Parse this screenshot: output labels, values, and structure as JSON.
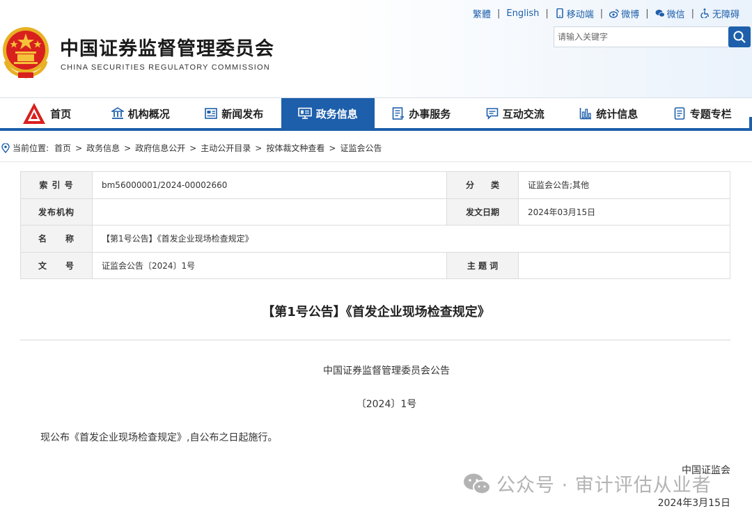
{
  "header": {
    "title": "中国证券监督管理委员会",
    "subtitle": "CHINA SECURITIES REGULATORY COMMISSION",
    "toplinks": {
      "traditional": "繁體",
      "english": "English",
      "mobile": "移动端",
      "weibo": "微博",
      "wechat": "微信",
      "accessibility": "无障碍"
    },
    "search": {
      "placeholder": "请输入关键字"
    }
  },
  "nav": {
    "items": [
      {
        "label": "首页",
        "icon": "emblem-icon"
      },
      {
        "label": "机构概况",
        "icon": "building-icon"
      },
      {
        "label": "新闻发布",
        "icon": "news-icon"
      },
      {
        "label": "政务信息",
        "icon": "monitor-icon",
        "active": true
      },
      {
        "label": "办事服务",
        "icon": "list-icon"
      },
      {
        "label": "互动交流",
        "icon": "chat-icon"
      },
      {
        "label": "统计信息",
        "icon": "bar-chart-icon"
      },
      {
        "label": "专题专栏",
        "icon": "document-icon"
      }
    ],
    "accent_color": "#1d5fab"
  },
  "breadcrumb": {
    "prefix": "当前位置:",
    "items": [
      "首页",
      "政务信息",
      "政府信息公开",
      "主动公开目录",
      "按体裁文种查看",
      "证监会公告"
    ],
    "separator": ">"
  },
  "meta": {
    "index_label": "索 引 号",
    "index_value": "bm56000001/2024-00002660",
    "category_label": "分　　类",
    "category_value": "证监会公告;其他",
    "issuer_label": "发布机构",
    "issuer_value": "",
    "date_label": "发文日期",
    "date_value": "2024年03月15日",
    "name_label": "名　　称",
    "name_value": "【第1号公告】《首发企业现场检查规定》",
    "docno_label": "文　　号",
    "docno_value": "证监会公告〔2024〕1号",
    "subject_label": "主 题 词",
    "subject_value": ""
  },
  "document": {
    "title": "【第1号公告】《首发企业现场检查规定》",
    "issuer_line": "中国证券监督管理委员会公告",
    "number_line": "〔2024〕1号",
    "body": "现公布《首发企业现场检查规定》,自公布之日起施行。",
    "signature": "中国证监会",
    "date": "2024年3月15日"
  },
  "watermark": {
    "text": "公众号 · 审计评估从业者",
    "icon": "wechat-icon"
  }
}
